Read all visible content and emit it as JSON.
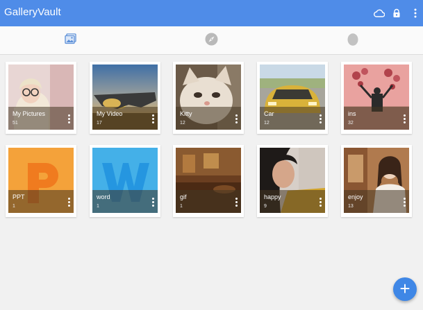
{
  "app": {
    "title": "GalleryVault",
    "actions": [
      {
        "icon": "cloud-icon"
      },
      {
        "icon": "lock-icon"
      },
      {
        "icon": "more-vert-icon"
      }
    ]
  },
  "tabs": [
    {
      "icon": "gallery-icon",
      "active": true
    },
    {
      "icon": "compass-icon",
      "active": false
    },
    {
      "icon": "egg-icon",
      "active": false
    }
  ],
  "folders": [
    {
      "name": "My Pictures",
      "count": "51"
    },
    {
      "name": "My Video",
      "count": "17"
    },
    {
      "name": "Kitty",
      "count": "12"
    },
    {
      "name": "Car",
      "count": "12"
    },
    {
      "name": "ins",
      "count": "32"
    },
    {
      "name": "PPT",
      "count": "1"
    },
    {
      "name": "word",
      "count": "1"
    },
    {
      "name": "gif",
      "count": "1"
    },
    {
      "name": "happy",
      "count": "9"
    },
    {
      "name": "enjoy",
      "count": "13"
    }
  ],
  "fab": {
    "label": "+"
  },
  "colors": {
    "appbar": "#4f8ce8",
    "accent": "#3f87e6"
  }
}
